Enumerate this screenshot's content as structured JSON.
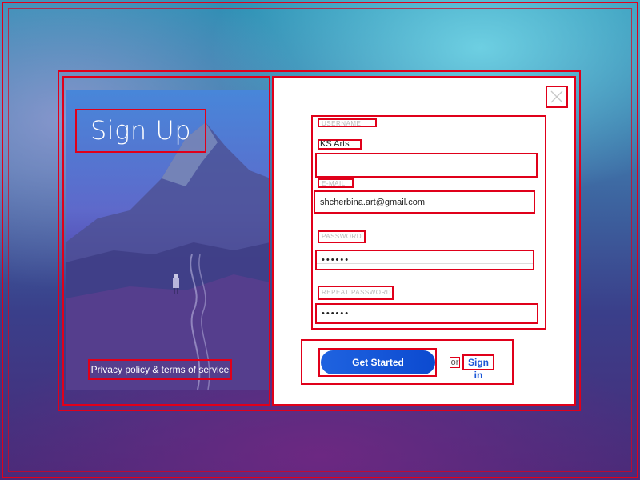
{
  "panel": {
    "title": "Sign Up",
    "privacy_link": "Privacy policy & terms of service"
  },
  "form": {
    "username": {
      "label": "USERNAME",
      "value": "KS Arts"
    },
    "email": {
      "label": "E-MAIL",
      "value": "shcherbina.art@gmail.com"
    },
    "password": {
      "label": "PASSWORD",
      "value": "••••••"
    },
    "repeat_password": {
      "label": "REPEAT PASSWORD",
      "value": "••••••"
    }
  },
  "actions": {
    "primary_label": "Get Started",
    "or_text": "or",
    "signin_label": "Sign in"
  },
  "icons": {
    "close": "close-icon"
  },
  "colors": {
    "accent": "#1a55d6",
    "annotation": "#e0001a"
  }
}
